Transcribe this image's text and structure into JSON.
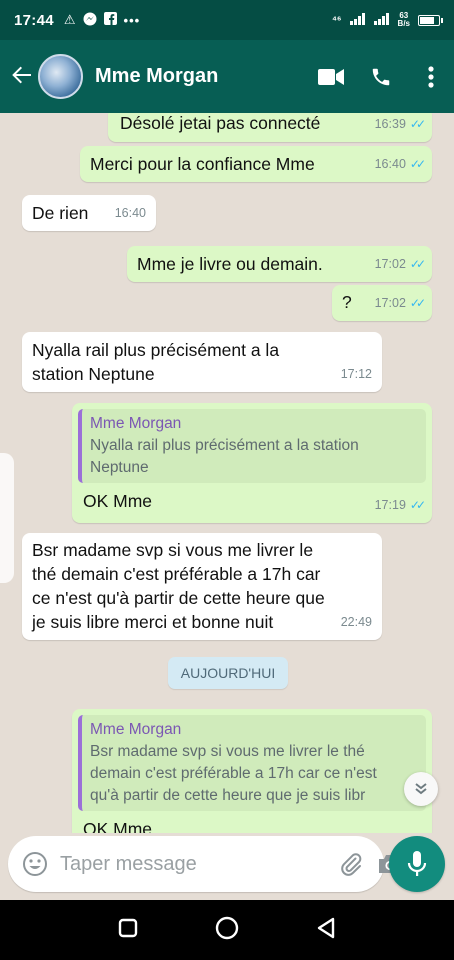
{
  "status_bar": {
    "time": "17:44",
    "left_icons": [
      "warning-icon",
      "messenger-icon",
      "facebook-icon",
      "more-dots-icon"
    ],
    "network_speed_value": "63",
    "network_speed_unit": "B/s",
    "battery_level": 0.85
  },
  "header": {
    "contact_name": "Mme Morgan",
    "actions": [
      "video-call-icon",
      "voice-call-icon",
      "menu-icon"
    ]
  },
  "messages": [
    {
      "direction": "out",
      "text": "Désolé jetai pas connecté",
      "time": "16:39",
      "status": "read"
    },
    {
      "direction": "out",
      "text": "Merci pour la confiance Mme",
      "time": "16:40",
      "status": "read"
    },
    {
      "direction": "in",
      "text": "De rien",
      "time": "16:40"
    },
    {
      "direction": "out",
      "text": "Mme je livre ou demain.",
      "time": "17:02",
      "status": "read"
    },
    {
      "direction": "out",
      "text": "?",
      "time": "17:02",
      "status": "read"
    },
    {
      "direction": "in",
      "text_lines": [
        "Nyalla rail plus précisément a la",
        "station Neptune"
      ],
      "time": "17:12"
    },
    {
      "direction": "out",
      "quote": {
        "author": "Mme Morgan",
        "lines": [
          "Nyalla rail plus précisément a la station",
          "Neptune"
        ]
      },
      "text": "OK Mme",
      "time": "17:19",
      "status": "read"
    },
    {
      "direction": "in",
      "text_lines": [
        "Bsr madame svp si vous me livrer le",
        "thé demain c'est préférable a 17h car",
        "ce n'est qu'à partir de cette heure que",
        "je suis libre merci et bonne nuit"
      ],
      "time": "22:49"
    },
    {
      "direction": "out",
      "quote": {
        "author": "Mme Morgan",
        "lines": [
          "Bsr madame svp si vous me livrer le thé",
          "demain c'est préférable a 17h car ce n'est",
          "qu'à partir de cette heure que je suis libr"
        ]
      },
      "text": "OK Mme"
    }
  ],
  "date_separator": "AUJOURD'HUI",
  "composer": {
    "placeholder": "Taper message"
  },
  "colors": {
    "header": "#075e54",
    "status_bar": "#054d44",
    "outgoing_bubble": "#dcf8c6",
    "incoming_bubble": "#ffffff",
    "read_ticks": "#34b7f1",
    "mic_button": "#128c7e"
  }
}
